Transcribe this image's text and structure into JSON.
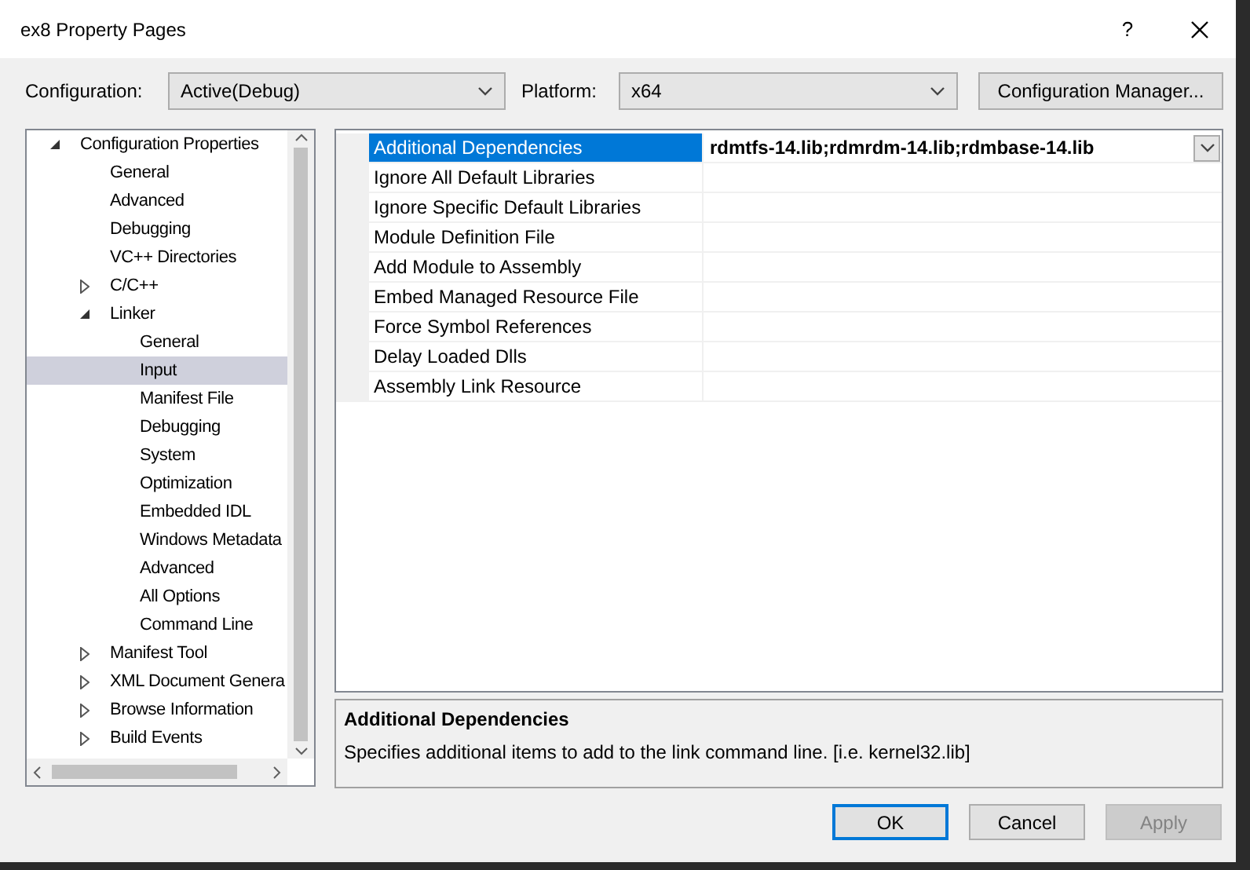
{
  "window": {
    "title": "ex8 Property Pages",
    "help": "?"
  },
  "configuration": {
    "label": "Configuration:",
    "value": "Active(Debug)"
  },
  "platform": {
    "label": "Platform:",
    "value": "x64"
  },
  "configuration_manager_button": "Configuration Manager...",
  "tree": [
    {
      "label": "Configuration Properties",
      "expanded": true,
      "selected": false,
      "children": [
        {
          "label": "General",
          "selected": false
        },
        {
          "label": "Advanced",
          "selected": false
        },
        {
          "label": "Debugging",
          "selected": false
        },
        {
          "label": "VC++ Directories",
          "selected": false
        },
        {
          "label": "C/C++",
          "expanded": false,
          "selected": false
        },
        {
          "label": "Linker",
          "expanded": true,
          "selected": false,
          "children": [
            {
              "label": "General",
              "selected": false
            },
            {
              "label": "Input",
              "selected": true
            },
            {
              "label": "Manifest File",
              "selected": false
            },
            {
              "label": "Debugging",
              "selected": false
            },
            {
              "label": "System",
              "selected": false
            },
            {
              "label": "Optimization",
              "selected": false
            },
            {
              "label": "Embedded IDL",
              "selected": false
            },
            {
              "label": "Windows Metadata",
              "selected": false
            },
            {
              "label": "Advanced",
              "selected": false
            },
            {
              "label": "All Options",
              "selected": false
            },
            {
              "label": "Command Line",
              "selected": false
            }
          ]
        },
        {
          "label": "Manifest Tool",
          "expanded": false,
          "selected": false
        },
        {
          "label": "XML Document Genera",
          "expanded": false,
          "selected": false
        },
        {
          "label": "Browse Information",
          "expanded": false,
          "selected": false
        },
        {
          "label": "Build Events",
          "expanded": false,
          "selected": false
        }
      ]
    }
  ],
  "properties": [
    {
      "name": "Additional Dependencies",
      "value": "rdmtfs-14.lib;rdmrdm-14.lib;rdmbase-14.lib",
      "selected": true
    },
    {
      "name": "Ignore All Default Libraries",
      "selected": false
    },
    {
      "name": "Ignore Specific Default Libraries",
      "selected": false
    },
    {
      "name": "Module Definition File",
      "selected": false
    },
    {
      "name": "Add Module to Assembly",
      "selected": false
    },
    {
      "name": "Embed Managed Resource File",
      "selected": false
    },
    {
      "name": "Force Symbol References",
      "selected": false
    },
    {
      "name": "Delay Loaded Dlls",
      "selected": false
    },
    {
      "name": "Assembly Link Resource",
      "selected": false
    }
  ],
  "description": {
    "title": "Additional Dependencies",
    "text": "Specifies additional items to add to the link command line. [i.e. kernel32.lib]"
  },
  "buttons": [
    {
      "label": "OK",
      "kind": "default"
    },
    {
      "label": "Cancel",
      "kind": "normal"
    },
    {
      "label": "Apply",
      "kind": "disabled"
    }
  ]
}
